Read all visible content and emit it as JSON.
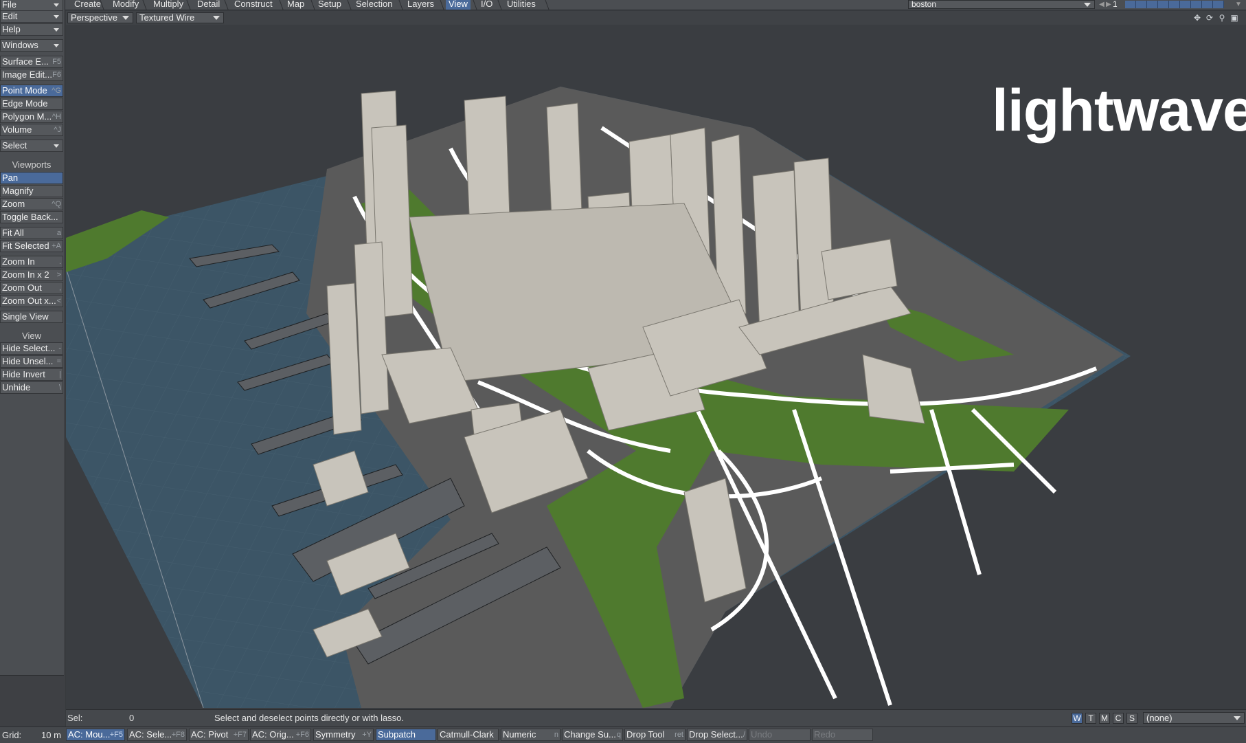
{
  "top_menu": {
    "tabs": [
      "Create",
      "Modify",
      "Multiply",
      "Detail",
      "Construct",
      "Map",
      "Setup",
      "Selection",
      "Layers",
      "View",
      "I/O",
      "Utilities"
    ],
    "active_tab": "View",
    "scene_name": "boston",
    "layer_number": "1"
  },
  "sidebar": {
    "file": "File",
    "edit": "Edit",
    "help": "Help",
    "windows": "Windows",
    "surface_editor": {
      "label": "Surface E...",
      "shortcut": "F5"
    },
    "image_editor": {
      "label": "Image Edit...",
      "shortcut": "F6"
    },
    "point_mode": {
      "label": "Point Mode",
      "shortcut": "^G"
    },
    "edge_mode": {
      "label": "Edge Mode",
      "shortcut": ""
    },
    "polygon_mode": {
      "label": "Polygon M...",
      "shortcut": "^H"
    },
    "volume": {
      "label": "Volume",
      "shortcut": "^J"
    },
    "select": "Select",
    "viewports_heading": "Viewports",
    "pan": {
      "label": "Pan",
      "shortcut": ""
    },
    "magnify": {
      "label": "Magnify",
      "shortcut": ""
    },
    "zoom": {
      "label": "Zoom",
      "shortcut": "^Q"
    },
    "toggle_background": {
      "label": "Toggle Back...",
      "shortcut": ""
    },
    "fit_all": {
      "label": "Fit All",
      "shortcut": "a"
    },
    "fit_selected": {
      "label": "Fit Selected",
      "shortcut": "+A"
    },
    "zoom_in": {
      "label": "Zoom In",
      "shortcut": "."
    },
    "zoom_in_x2": {
      "label": "Zoom In x 2",
      "shortcut": ">"
    },
    "zoom_out": {
      "label": "Zoom Out",
      "shortcut": ","
    },
    "zoom_out_x2": {
      "label": "Zoom Out x...",
      "shortcut": "<"
    },
    "single_view": {
      "label": "Single View",
      "shortcut": ""
    },
    "view_heading": "View",
    "hide_selected": {
      "label": "Hide Select...",
      "shortcut": "-"
    },
    "hide_unselected": {
      "label": "Hide Unsel...",
      "shortcut": "="
    },
    "hide_invert": {
      "label": "Hide Invert",
      "shortcut": "|"
    },
    "unhide": {
      "label": "Unhide",
      "shortcut": "\\"
    }
  },
  "viewport": {
    "view_type": "Perspective",
    "render_mode": "Textured Wire",
    "overlay_title": "lightwave"
  },
  "status": {
    "sel_label": "Sel:",
    "sel_value": "0",
    "message": "Select and deselect points directly or with lasso.",
    "wtmcs": [
      "W",
      "T",
      "M",
      "C",
      "S"
    ],
    "wtmcs_active": "W",
    "morph_select": "(none)"
  },
  "bottom_bar": {
    "grid_label": "Grid:",
    "grid_value": "10 m",
    "buttons": [
      {
        "label": "AC: Mou...",
        "shortcut": "+F5"
      },
      {
        "label": "AC: Sele...",
        "shortcut": "+F8"
      },
      {
        "label": "AC: Pivot",
        "shortcut": "+F7"
      },
      {
        "label": "AC: Orig...",
        "shortcut": "+F6"
      },
      {
        "label": "Symmetry",
        "shortcut": "+Y"
      },
      {
        "label": "Subpatch",
        "shortcut": ""
      },
      {
        "label": "Catmull-Clark",
        "shortcut": ""
      },
      {
        "label": "Numeric",
        "shortcut": "n"
      },
      {
        "label": "Change Su...",
        "shortcut": "q"
      },
      {
        "label": "Drop Tool",
        "shortcut": "ret"
      },
      {
        "label": "Drop Select...",
        "shortcut": "/"
      },
      {
        "label": "Undo",
        "shortcut": ""
      },
      {
        "label": "Redo",
        "shortcut": ""
      }
    ]
  },
  "colors": {
    "panel": "#4b4e52",
    "button": "#55585c",
    "accent": "#4a6a9a",
    "viewport_bg": "#3a3d41",
    "water": "#3c5566",
    "grass": "#4f7a2e",
    "road": "#ffffff",
    "ground": "#5a5a5a",
    "building": "#c8c4bb"
  },
  "icons": [
    "move-view-icon",
    "rotate-view-icon",
    "zoom-view-icon",
    "maximize-view-icon"
  ]
}
